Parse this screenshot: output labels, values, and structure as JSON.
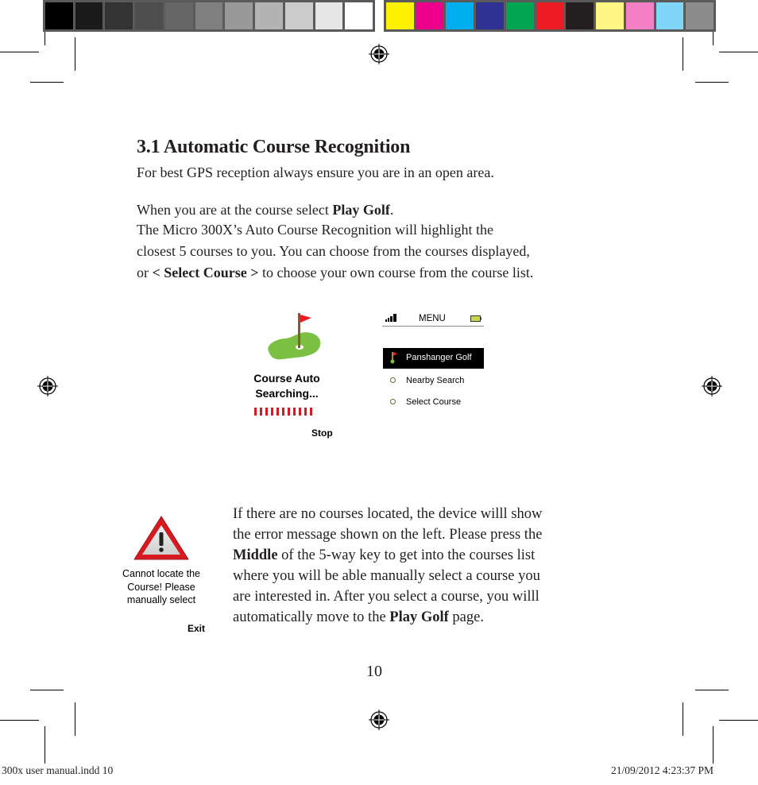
{
  "color_bar_left": [
    "#000000",
    "#1a1a1a",
    "#333333",
    "#4d4d4d",
    "#666666",
    "#808080",
    "#999999",
    "#b3b3b3",
    "#cccccc",
    "#e6e6e6",
    "#ffffff"
  ],
  "color_bar_right": [
    "#fff200",
    "#ec008c",
    "#00aeef",
    "#2e3192",
    "#00a651",
    "#ed1c24",
    "#231f20",
    "#fff685",
    "#f680c6",
    "#7fd6f7",
    "#8c8c8c"
  ],
  "section": {
    "title": "3.1 Automatic Course Recognition",
    "line1": "For best GPS reception always ensure you are in an open area.",
    "line2_pre": "When you are at the course select ",
    "line2_bold": "Play Golf",
    "line2_post": ".",
    "line3": "The Micro 300X’s Auto Course Recognition will highlight the",
    "line4": "closest 5 courses to you. You can choose from the courses displayed,",
    "line5_pre": "or ",
    "line5_bold": "< Select Course >",
    "line5_post": " to choose your own course from the course list."
  },
  "search_screen": {
    "icon": "golf-flag-green-icon",
    "title_line1": "Course Auto",
    "title_line2": "Searching...",
    "progress_ticks": 11,
    "stop_label": "Stop"
  },
  "menu_screen": {
    "title": "MENU",
    "signal_icon": "signal-bars-icon",
    "battery_icon": "battery-icon",
    "items": [
      {
        "label": "Panshanger Golf",
        "icon": "golf-flag-icon",
        "selected": true
      },
      {
        "label": "Nearby Search",
        "icon": "circle-bullet-icon",
        "selected": false
      },
      {
        "label": "Select Course",
        "icon": "circle-bullet-icon",
        "selected": false
      }
    ]
  },
  "error_screen": {
    "icon": "warning-triangle-icon",
    "line1": "Cannot locate the",
    "line2": "Course! Please",
    "line3": "manually select",
    "exit_label": "Exit"
  },
  "error_paragraph": {
    "l1": "If there are no courses located, the device willl show",
    "l2": "the error message shown on the left. Please press the",
    "l3_bold": "Middle",
    "l3_post": " of the 5-way key to get into the courses list",
    "l4": "where you will be able manually select a course you",
    "l5": "are interested in. After you select a course, you willl",
    "l6_pre": "automatically  move to the ",
    "l6_bold": "Play Golf",
    "l6_post": " page."
  },
  "page_number": "10",
  "slug": {
    "left": "300x user manual.indd   10",
    "right": "21/09/2012   4:23:37 PM"
  }
}
